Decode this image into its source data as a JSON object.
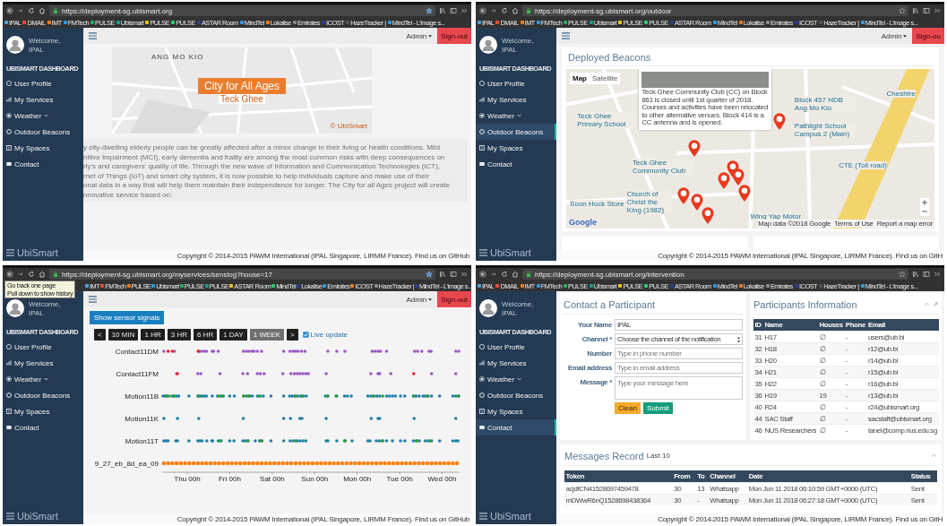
{
  "screens": [
    {
      "url": "https://deployment-sg.ubismart.org",
      "bookmarks": [
        "IPAL",
        "DMAIL",
        "IMT",
        "FMTech",
        "PULSE",
        "Ubismart",
        "PULSE",
        "PULSE",
        "ASTAR Room",
        "MindTel",
        "Lokalise",
        "Emirates",
        "ICOST",
        "HazeTracker |",
        "MindTel - L'image s..."
      ],
      "user": {
        "greeting": "Welcome,",
        "name": "IPAL"
      },
      "sidebar": {
        "heading": "UBISMART DASHBOARD",
        "brand": "UbiSmart",
        "items": [
          {
            "label": "User Profile",
            "selected": false,
            "has_submenu": false
          },
          {
            "label": "My Services",
            "selected": false,
            "has_submenu": false
          },
          {
            "label": "Weather",
            "selected": false,
            "has_submenu": true
          },
          {
            "label": "Outdoor Beacons",
            "selected": false,
            "has_submenu": false
          },
          {
            "label": "My Spaces",
            "selected": false,
            "has_submenu": false
          },
          {
            "label": "Contact",
            "selected": false,
            "has_submenu": false
          }
        ]
      },
      "topbar": {
        "account": "Admin",
        "sign_out": "Sign-out"
      },
      "content": {
        "kind": "home",
        "hero": {
          "title": "City for All Ages",
          "subtitle": "Teck Ghee",
          "street_label": "ANG MO KIO",
          "credit": "© UbiSmart"
        },
        "intro_lines": [
          "y city-dwelling elderly people can be greatly affected after a minor change in their living or health conditions. Mild",
          "nitive Impairment (MCI), early dementia and frailty are among the most common risks with deep consequences on",
          "rly's and caregivers' quality of life. Through the new wave of Information and Communication Technologies (ICT),",
          "rnet of Things (IoT) and smart city system, it is now possible to help individuals capture and make use of their",
          "onal data in a way that will help them maintain their independence for longer. The City for all Ages project will create",
          "nnovative service based on:"
        ]
      },
      "footer": "Copyright © 2014-2015 PAWM International (IPAL Singapore, LIRMM France). Find us on GitHub"
    },
    {
      "url": "https://deployment-sg.ubismart.org/outdoor",
      "bookmarks": [
        "IPAL",
        "DMAIL",
        "IMT",
        "FMTech",
        "PULSE",
        "Ubismart",
        "PULSE",
        "PULSE",
        "ASTAR Room",
        "MindTel",
        "Lokalise",
        "Emirates",
        "ICOST",
        "HazeTracker |",
        "MindTel - L'image s..."
      ],
      "user": {
        "greeting": "Welcome,",
        "name": "IPAL"
      },
      "sidebar": {
        "heading": "UBISMART DASHBOARD",
        "brand": "UbiSmart",
        "items": [
          {
            "label": "User Profile",
            "selected": false,
            "has_submenu": false
          },
          {
            "label": "My Services",
            "selected": false,
            "has_submenu": false
          },
          {
            "label": "Weather",
            "selected": false,
            "has_submenu": true
          },
          {
            "label": "Outdoor Beacons",
            "selected": true,
            "has_submenu": false
          },
          {
            "label": "My Spaces",
            "selected": false,
            "has_submenu": false
          },
          {
            "label": "Contact",
            "selected": false,
            "has_submenu": false
          }
        ]
      },
      "topbar": {
        "account": "Admin",
        "sign_out": "Sign-ou"
      },
      "content": {
        "kind": "beacons",
        "title": "Deployed Beacons",
        "map_types": [
          {
            "label": "Map",
            "selected": true
          },
          {
            "label": "Satellite",
            "selected": false
          }
        ],
        "info_text": "Teck Ghee Community Club (CC) on Block 861 is closed until 1st quarter of 2018. Courses and activities have been relocated to other alternative venues. Block 414 is a CC antenna and is opened.",
        "places": [
          "Teck Ghee Primary School",
          "Teck Ghee Community Club",
          "Block 457 HDB Ang Mo Kio",
          "Pathlight School Campus 2 (Main)",
          "Cheshire",
          "Soon Hock Store",
          "Church of Christ the King (1982)",
          "Wing Yap Motor",
          "CTE (Toll road)"
        ],
        "map_logo": "Google",
        "attribution": [
          "Map data ©2018 Google",
          "Terms of Use",
          "Report a map error"
        ]
      },
      "footer": "Copyright © 2014-2015 PAWM International (IPAL Singapore, LIRMM France). Find us on GitH"
    },
    {
      "url": "https://deployment-sg.ubismart.org/myservices/senslog?house=17",
      "tooltip": [
        "Go back one page",
        "Pull down to show history"
      ],
      "bookmarks": [
        "IMT",
        "FMTech",
        "PULSE",
        "Ubismart",
        "PULSE",
        "PULSE",
        "ASTAR Room",
        "MindTel",
        "Lokalise",
        "Emirates",
        "ICOST",
        "HazeTracker |",
        "MindTel - L'image s..."
      ],
      "user": {
        "greeting": "Welcome,",
        "name": "IPAL"
      },
      "sidebar": {
        "heading": "UBISMART DASHBOARD",
        "brand": "UbiSmart",
        "items": [
          {
            "label": "User Profile",
            "selected": false,
            "has_submenu": false
          },
          {
            "label": "My Services",
            "selected": false,
            "has_submenu": false
          },
          {
            "label": "Weather",
            "selected": false,
            "has_submenu": true
          },
          {
            "label": "Outdoor Beacons",
            "selected": false,
            "has_submenu": false
          },
          {
            "label": "My Spaces",
            "selected": false,
            "has_submenu": false
          },
          {
            "label": "Contact",
            "selected": false,
            "has_submenu": false
          }
        ]
      },
      "topbar": {
        "account": "Admin",
        "sign_out": "Sign-out"
      },
      "content": {
        "kind": "sensors",
        "show_button": "Show sensor signals",
        "prev": "<",
        "next": ">",
        "ranges": [
          {
            "label": "10 MIN",
            "selected": false
          },
          {
            "label": "1 HR",
            "selected": false
          },
          {
            "label": "3 HR",
            "selected": false
          },
          {
            "label": "6 HR",
            "selected": false
          },
          {
            "label": "1 DAY",
            "selected": false
          },
          {
            "label": "1 WEEK",
            "selected": true
          }
        ],
        "live_update": {
          "label": "Live update",
          "checked": true
        },
        "timeline": {
          "rows": [
            "Contact11DM",
            "Contact11FM",
            "Motion11B",
            "Motion11K",
            "Motion11T",
            "9_27_eb_8d_ea_09"
          ],
          "time_labels": [
            "Thu 00h",
            "Fri 00h",
            "Sat 00h",
            "Sun 00h",
            "Mon 00h",
            "Tue 00h",
            "Wed 00h"
          ]
        }
      },
      "footer": "Copyright © 2014-2015 PAWM International (IPAL Singapore, LIRMM France). Find us on GitHub"
    },
    {
      "url": "https://deployment-sg.ubismart.org/intervention",
      "bookmarks": [
        "IPAL",
        "DMAIL",
        "IMT",
        "FMTech",
        "PULSE",
        "Ubismart",
        "PULSE",
        "PULSE",
        "ASTAR Room",
        "MindTel",
        "Lokalise",
        "Emirates",
        "ICOST",
        "HazeTracker |",
        "MindTel - L'image s..."
      ],
      "user": {
        "greeting": "Welcome,",
        "name": "IPAL"
      },
      "sidebar": {
        "heading": "UBISMART DASHBOARD",
        "brand": "UbiSmart",
        "items": [
          {
            "label": "User Profile",
            "selected": false,
            "has_submenu": false
          },
          {
            "label": "My Services",
            "selected": false,
            "has_submenu": false
          },
          {
            "label": "Weather",
            "selected": false,
            "has_submenu": true
          },
          {
            "label": "Outdoor Beacons",
            "selected": false,
            "has_submenu": false
          },
          {
            "label": "My Spaces",
            "selected": false,
            "has_submenu": false
          },
          {
            "label": "Contact",
            "selected": true,
            "has_submenu": false
          }
        ]
      },
      "content": {
        "kind": "contact",
        "form": {
          "title": "Contact a Participant",
          "fields": [
            {
              "kind": "text",
              "label": "Your Name",
              "value": "IPAL"
            },
            {
              "kind": "select",
              "label": "Channel *",
              "value": "Choose the channel of the notification"
            },
            {
              "kind": "text",
              "label": "Number",
              "placeholder": "Type in phone number"
            },
            {
              "kind": "text",
              "label": "Email address",
              "placeholder": "Type in email address"
            },
            {
              "kind": "textarea",
              "label": "Message *",
              "placeholder": "Type your message here"
            }
          ],
          "clear_button": "Clean",
          "submit_button": "Submit"
        },
        "participants": {
          "title": "Participants Information",
          "columns": [
            "ID",
            "Name",
            "Houses",
            "Phone",
            "Email"
          ],
          "rows": [
            [
              "31",
              "H17",
              "∅",
              "-",
              "users@ub.bi"
            ],
            [
              "32",
              "H18",
              "∅",
              "-",
              "r12@ub.bi"
            ],
            [
              "33",
              "H20",
              "∅",
              "-",
              "r14@ub.bi"
            ],
            [
              "34",
              "H21",
              "∅",
              "-",
              "r15@ub.bi"
            ],
            [
              "35",
              "H22",
              "∅",
              "-",
              "r16@ub.bi"
            ],
            [
              "36",
              "H19",
              "19",
              "-",
              "r13@ub.bi"
            ],
            [
              "40",
              "R24",
              "∅",
              "-",
              "r24@ubismart.org"
            ],
            [
              "44",
              "SAC Staff",
              "∅",
              "-",
              "sacstaff@ubismart.org"
            ],
            [
              "46",
              "NUS Researchers",
              "∅",
              "-",
              "tanel@comp.nus.edu.sg"
            ]
          ]
        },
        "messages": {
          "title": "Messages Record",
          "subtitle": "Last 10",
          "columns": [
            "Token",
            "From",
            "To",
            "Channel",
            "Date",
            "Status"
          ],
          "rows": [
            [
              "acjdfCN41528697459478",
              "30",
              "13",
              "Whatsapp",
              "Mon Jun 11 2018 06:10:59 GMT+0000 (UTC)",
              "Sent"
            ],
            [
              "mDWwR6nQ1528698438364",
              "30",
              "-",
              "Whatsapp",
              "Mon Jun 11 2018 06:27:18 GMT+0000 (UTC)",
              "Sent"
            ]
          ]
        }
      },
      "footer": "Copyright © 2014-2015 PAWM International (IPAL Singapore, LIRMM France). Find us on GitH"
    }
  ]
}
